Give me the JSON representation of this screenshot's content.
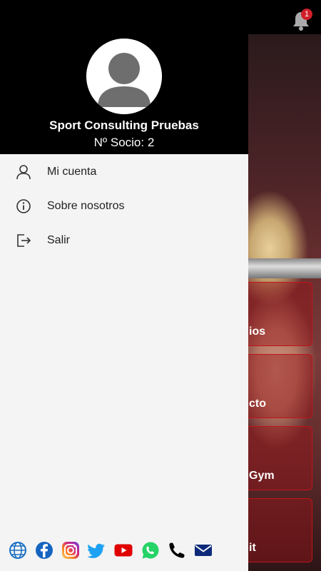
{
  "notifications": {
    "count": "1",
    "icon": "bell-icon"
  },
  "background_cards": [
    {
      "label": "ios"
    },
    {
      "label": "cto"
    },
    {
      "label": "Gym"
    },
    {
      "label": "it"
    }
  ],
  "drawer": {
    "user": {
      "name": "Sport Consulting Pruebas",
      "member_label": "Nº Socio:",
      "member_number": "2"
    },
    "menu": [
      {
        "label": "Mi cuenta",
        "icon": "user-icon"
      },
      {
        "label": "Sobre nosotros",
        "icon": "info-icon"
      },
      {
        "label": "Salir",
        "icon": "logout-icon"
      }
    ],
    "social": [
      {
        "name": "website",
        "icon": "globe-icon",
        "color": "#1a6fc4"
      },
      {
        "name": "facebook",
        "icon": "facebook-icon",
        "color": "#1565c0"
      },
      {
        "name": "instagram",
        "icon": "instagram-icon",
        "color": "#c13584"
      },
      {
        "name": "twitter",
        "icon": "twitter-icon",
        "color": "#1da1f2"
      },
      {
        "name": "youtube",
        "icon": "youtube-icon",
        "color": "#e00000"
      },
      {
        "name": "whatsapp",
        "icon": "whatsapp-icon",
        "color": "#25d366"
      },
      {
        "name": "phone",
        "icon": "phone-icon",
        "color": "#000000"
      },
      {
        "name": "email",
        "icon": "mail-icon",
        "color": "#0d2a7a"
      }
    ]
  },
  "colors": {
    "accent": "#c2141a",
    "drawer_bg": "#f4f4f4",
    "header_bg": "#000000"
  }
}
